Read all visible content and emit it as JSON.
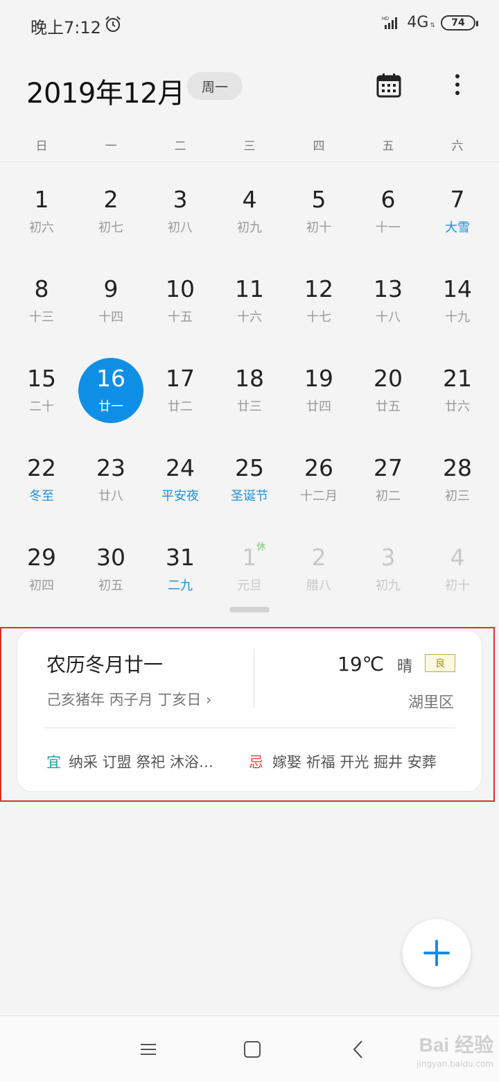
{
  "status_bar": {
    "time": "晚上7:12",
    "hd": "HD",
    "network": "4G",
    "battery": "74"
  },
  "header": {
    "month_title": "2019年12月",
    "weekday_pill": "周一"
  },
  "weekdays": [
    "日",
    "一",
    "二",
    "三",
    "四",
    "五",
    "六"
  ],
  "weeks": [
    [
      {
        "num": "1",
        "lunar": "初六"
      },
      {
        "num": "2",
        "lunar": "初七"
      },
      {
        "num": "3",
        "lunar": "初八"
      },
      {
        "num": "4",
        "lunar": "初九"
      },
      {
        "num": "5",
        "lunar": "初十"
      },
      {
        "num": "6",
        "lunar": "十一"
      },
      {
        "num": "7",
        "lunar": "大雪"
      }
    ],
    [
      {
        "num": "8",
        "lunar": "十三"
      },
      {
        "num": "9",
        "lunar": "十四"
      },
      {
        "num": "10",
        "lunar": "十五"
      },
      {
        "num": "11",
        "lunar": "十六"
      },
      {
        "num": "12",
        "lunar": "十七"
      },
      {
        "num": "13",
        "lunar": "十八"
      },
      {
        "num": "14",
        "lunar": "十九"
      }
    ],
    [
      {
        "num": "15",
        "lunar": "二十"
      },
      {
        "num": "16",
        "lunar": "廿一"
      },
      {
        "num": "17",
        "lunar": "廿二"
      },
      {
        "num": "18",
        "lunar": "廿三"
      },
      {
        "num": "19",
        "lunar": "廿四"
      },
      {
        "num": "20",
        "lunar": "廿五"
      },
      {
        "num": "21",
        "lunar": "廿六"
      }
    ],
    [
      {
        "num": "22",
        "lunar": "冬至"
      },
      {
        "num": "23",
        "lunar": "廿八"
      },
      {
        "num": "24",
        "lunar": "平安夜"
      },
      {
        "num": "25",
        "lunar": "圣诞节"
      },
      {
        "num": "26",
        "lunar": "十二月"
      },
      {
        "num": "27",
        "lunar": "初二"
      },
      {
        "num": "28",
        "lunar": "初三"
      }
    ],
    [
      {
        "num": "29",
        "lunar": "初四"
      },
      {
        "num": "30",
        "lunar": "初五"
      },
      {
        "num": "31",
        "lunar": "二九"
      },
      {
        "num": "1",
        "lunar": "元旦",
        "badge": "休"
      },
      {
        "num": "2",
        "lunar": "腊八"
      },
      {
        "num": "3",
        "lunar": "初九"
      },
      {
        "num": "4",
        "lunar": "初十"
      }
    ]
  ],
  "info_card": {
    "lunar_date": "农历冬月廿一",
    "ganzhi": "己亥猪年 丙子月 丁亥日",
    "temperature": "19℃",
    "weather": "晴",
    "aqi": "良",
    "district": "湖里区",
    "yi_label": "宜",
    "yi_items": "纳采 订盟 祭祀 沐浴…",
    "ji_label": "忌",
    "ji_items": "嫁娶 祈福 开光 掘井 安葬"
  },
  "watermark": {
    "main": "Bai 经验",
    "sub": "jingyan.baidu.com"
  },
  "colors": {
    "accent": "#0f8ee6",
    "holiday_text": "#1e90d8",
    "yi": "#1aa49a",
    "ji": "#e0493c",
    "highlight_border": "#d9312b"
  }
}
